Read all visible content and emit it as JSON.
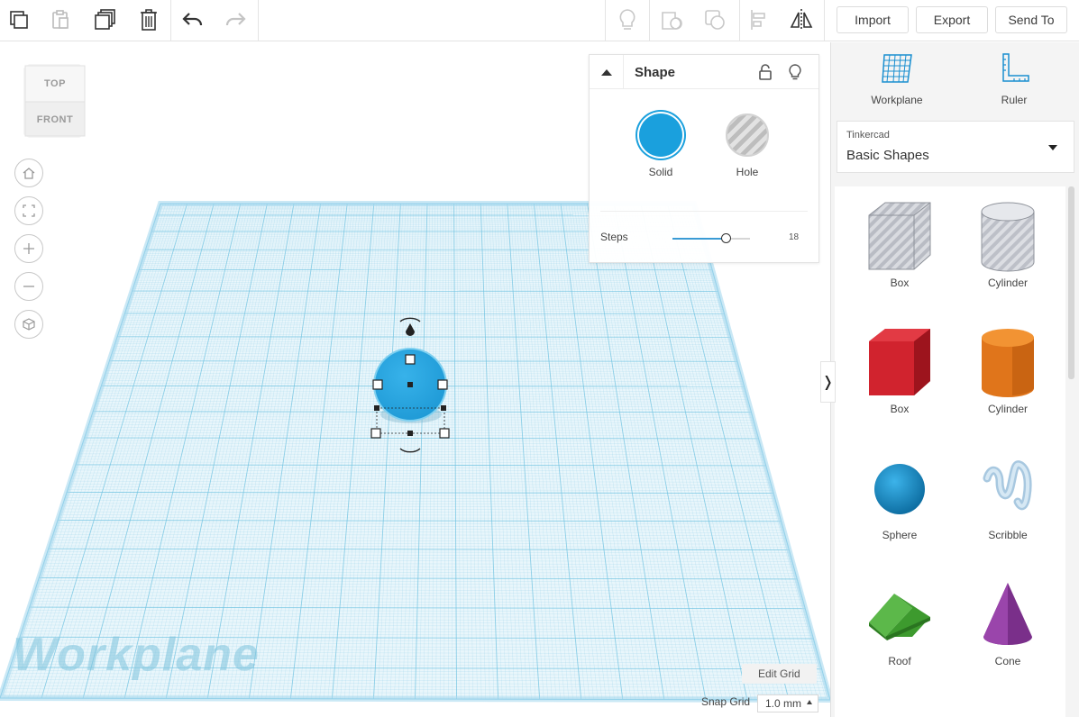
{
  "toolbar": {
    "left_tools": [
      "copy-icon",
      "paste-icon",
      "duplicate-icon",
      "delete-icon",
      "undo-icon",
      "redo-icon"
    ],
    "right_tools": [
      "show-all-icon",
      "hole-icon",
      "group-icon",
      "align-icon",
      "mirror-icon"
    ],
    "import_label": "Import",
    "export_label": "Export",
    "sendto_label": "Send To"
  },
  "viewcube": {
    "top_label": "TOP",
    "front_label": "FRONT"
  },
  "nav_buttons": [
    "home-view-icon",
    "fit-view-icon",
    "zoom-in-icon",
    "zoom-out-icon",
    "ortho-view-icon"
  ],
  "viewport": {
    "workplane_label": "Workplane",
    "edit_grid_label": "Edit Grid",
    "snap_grid_label": "Snap Grid",
    "snap_grid_value": "1.0 mm",
    "grid_color": "#6ec1e0",
    "selected_shape_color": "#1f9ad6"
  },
  "inspector": {
    "title": "Shape",
    "solid_label": "Solid",
    "hole_label": "Hole",
    "solid_color": "#1aa0dd",
    "steps_label": "Steps",
    "steps_value": "18",
    "steps_fraction": 0.7
  },
  "right_panel": {
    "workplane_label": "Workplane",
    "ruler_label": "Ruler",
    "library_source": "Tinkercad",
    "library_name": "Basic Shapes",
    "collapse_glyph": "❭",
    "shapes": [
      {
        "label": "Box",
        "icon": "box-hole-icon"
      },
      {
        "label": "Cylinder",
        "icon": "cylinder-hole-icon"
      },
      {
        "label": "Box",
        "icon": "box-icon"
      },
      {
        "label": "Cylinder",
        "icon": "cylinder-icon"
      },
      {
        "label": "Sphere",
        "icon": "sphere-icon"
      },
      {
        "label": "Scribble",
        "icon": "scribble-icon"
      },
      {
        "label": "Roof",
        "icon": "roof-icon"
      },
      {
        "label": "Cone",
        "icon": "cone-icon"
      }
    ]
  }
}
